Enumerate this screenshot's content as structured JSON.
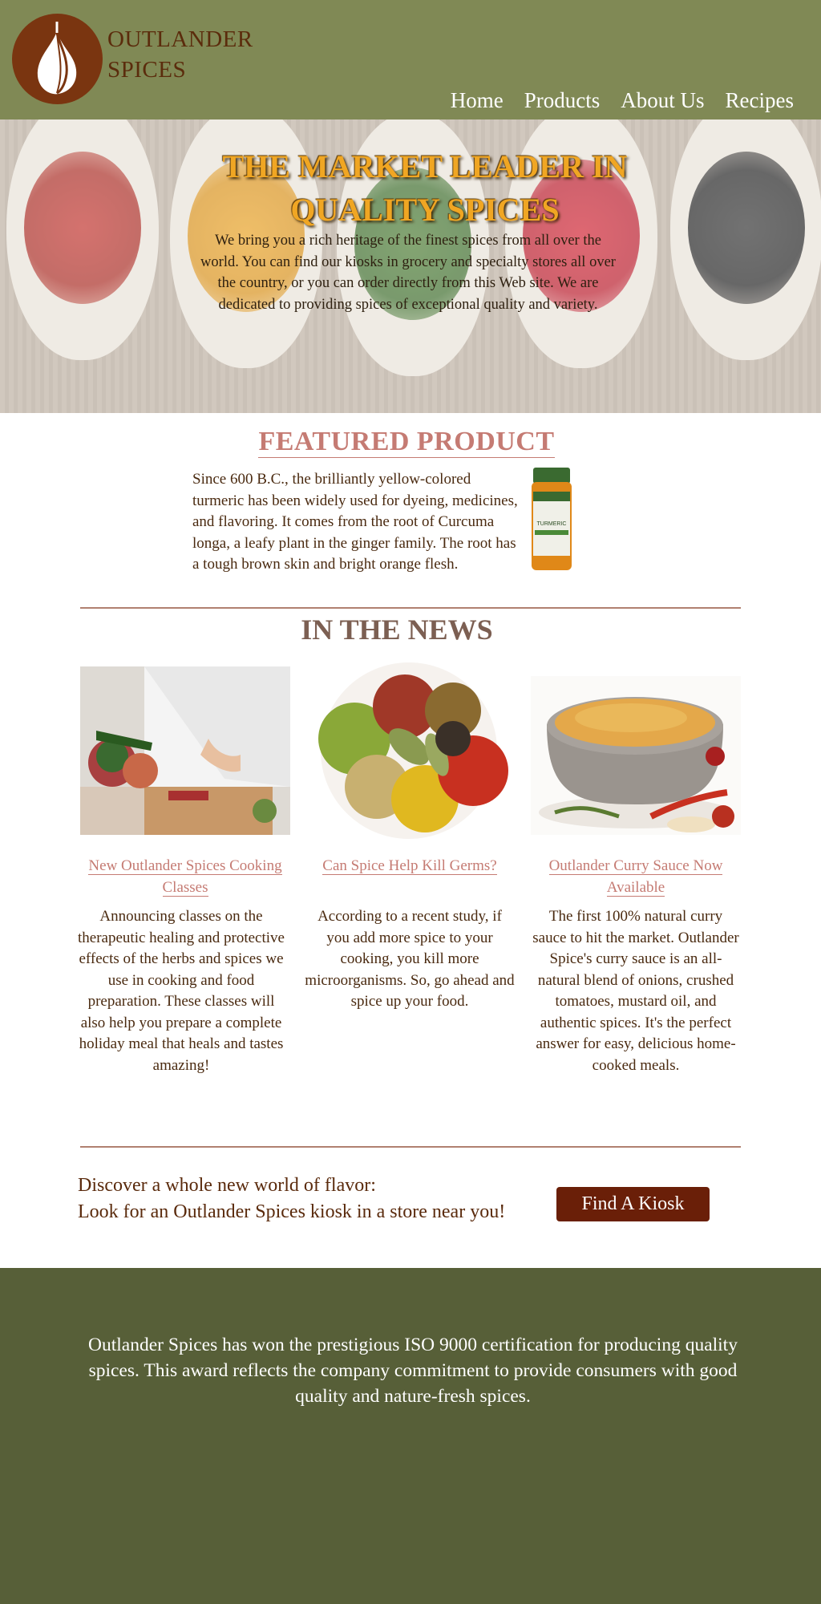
{
  "header": {
    "logo_line1": "OUTLANDER",
    "logo_line2": "SPICES",
    "nav": [
      "Home",
      "Products",
      "About Us",
      "Recipes"
    ]
  },
  "hero": {
    "title_line1": "THE MARKET LEADER IN",
    "title_line2": "QUALITY SPICES",
    "text": "We bring you a rich heritage of the finest spices from all over the world. You can find our kiosks in grocery and specialty stores all over the country, or you can order directly from this Web site. We are dedicated to providing spices of exceptional quality and variety."
  },
  "featured": {
    "title": "FEATURED PRODUCT",
    "text": "Since 600 B.C., the brilliantly yellow-colored turmeric has been widely used for dyeing, medicines, and flavoring. It comes from the root of Curcuma longa, a leafy plant in the ginger family. The root has a tough brown skin and bright orange flesh.",
    "jar_label": "TURMERIC"
  },
  "news": {
    "title": "IN THE NEWS",
    "items": [
      {
        "link": "New Outlander Spices Cooking Classes",
        "text": "Announcing classes on the therapeutic healing and protective effects of the herbs and spices we use in cooking and food preparation. These classes will also help you prepare a complete holiday meal that heals and tastes amazing!"
      },
      {
        "link": "Can Spice Help Kill Germs?",
        "text": "According to a recent study, if you add more spice to your cooking, you kill more microorganisms. So, go ahead and spice up your food."
      },
      {
        "link": "Outlander Curry Sauce Now Available",
        "text": "The first 100% natural curry sauce to hit the market. Outlander Spice's curry sauce is an all-natural blend of onions, crushed tomatoes, mustard oil, and authentic spices. It's the perfect answer for easy, delicious home-cooked meals."
      }
    ]
  },
  "cta": {
    "line1": "Discover a whole new world of flavor:",
    "line2": "Look for an Outlander Spices kiosk in a store near you!",
    "button": "Find A Kiosk"
  },
  "footer": {
    "text": "Outlander Spices has won the prestigious ISO 9000 certification for producing quality spices. This award reflects the company commitment to provide consumers with good quality and nature-fresh spices."
  },
  "colors": {
    "header_bg": "#808955",
    "logo_brown": "#7a3510",
    "accent_rose": "#c57b73",
    "button_bg": "#6a1f08",
    "footer_bg": "#575f38",
    "hero_title": "#f0a623"
  }
}
